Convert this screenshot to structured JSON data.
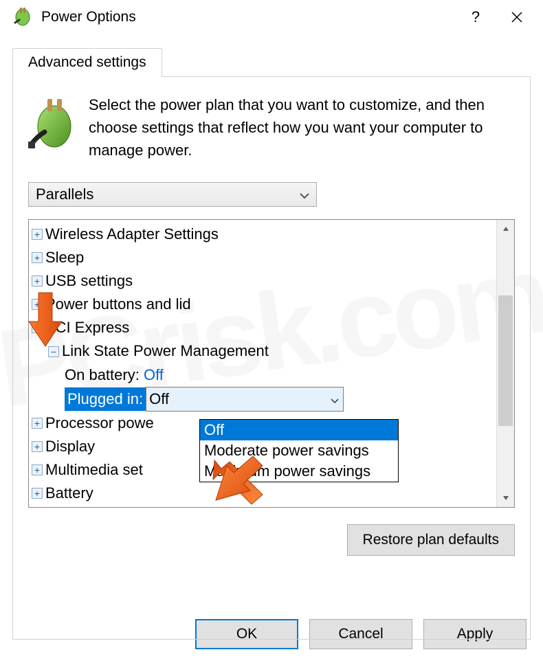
{
  "title": "Power Options",
  "tab": "Advanced settings",
  "intro": "Select the power plan that you want to customize, and then choose settings that reflect how you want your computer to manage power.",
  "plan": "Parallels",
  "tree": {
    "wireless": "Wireless Adapter Settings",
    "sleep": "Sleep",
    "usb": "USB settings",
    "powerbtn": "Power buttons and lid",
    "pci": "PCI Express",
    "link": "Link State Power Management",
    "onbat_label": "On battery:",
    "onbat_val": "Off",
    "plugged_label": "Plugged in:",
    "plugged_val": "Off",
    "proc": "Processor powe",
    "display": "Display",
    "multimedia": "Multimedia set",
    "battery": "Battery"
  },
  "dropdown": {
    "opt1": "Off",
    "opt2": "Moderate power savings",
    "opt3": "Maximum power savings"
  },
  "restore": "Restore plan defaults",
  "buttons": {
    "ok": "OK",
    "cancel": "Cancel",
    "apply": "Apply"
  }
}
